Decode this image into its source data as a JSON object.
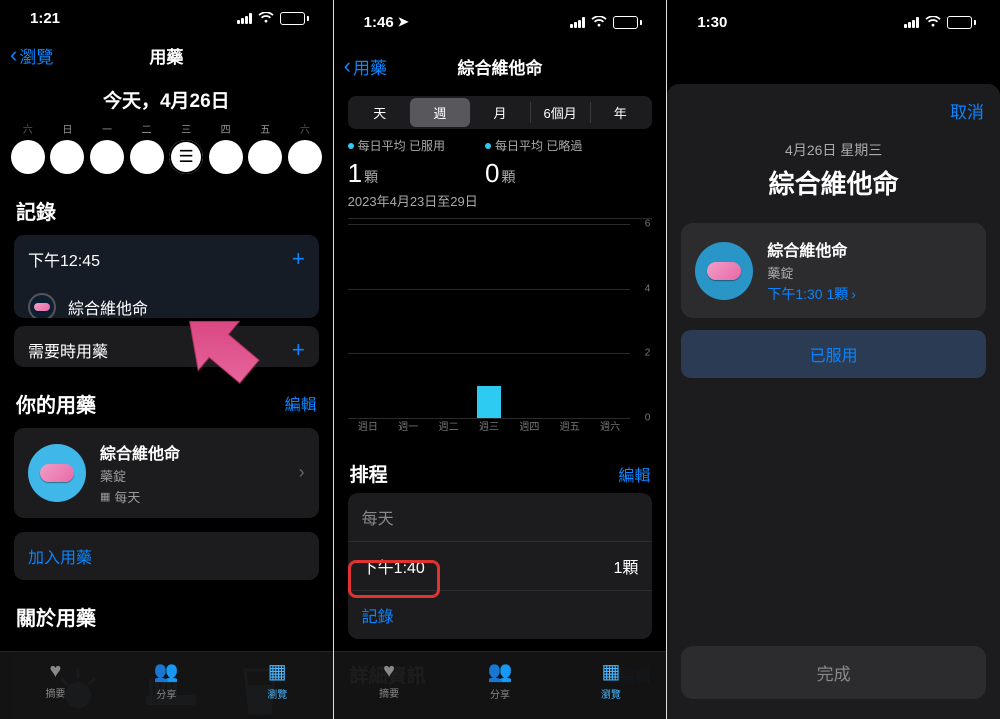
{
  "s1": {
    "time": "1:21",
    "battery": "87",
    "back": "瀏覽",
    "title": "用藥",
    "date_header": "今天，4月26日",
    "week_labels": [
      "六",
      "日",
      "一",
      "二",
      "三",
      "四",
      "五",
      "六"
    ],
    "section_log": "記錄",
    "log_time": "下午12:45",
    "med_name": "綜合維他命",
    "as_needed": "需要時用藥",
    "section_your": "你的用藥",
    "edit": "編輯",
    "med_type": "藥錠",
    "freq": "每天",
    "add_med": "加入用藥",
    "section_about": "關於用藥",
    "tabs": {
      "summary": "摘要",
      "share": "分享",
      "browse": "瀏覽"
    }
  },
  "s2": {
    "time": "1:46",
    "battery": "86",
    "back": "用藥",
    "title": "綜合維他命",
    "segs": [
      "天",
      "週",
      "月",
      "6個月",
      "年"
    ],
    "legend": {
      "taken_label": "每日平均 已服用",
      "skipped_label": "每日平均 已略過",
      "taken_val": "1",
      "skipped_val": "0",
      "unit": "顆"
    },
    "range": "2023年4月23日至29日",
    "xlabels": [
      "週日",
      "週一",
      "週二",
      "週三",
      "週四",
      "週五",
      "週六"
    ],
    "section_schedule": "排程",
    "edit": "編輯",
    "sched_freq": "每天",
    "sched_time": "下午1:40",
    "sched_qty": "1顆",
    "record": "記錄",
    "section_detail": "詳細資訊",
    "tabs": {
      "summary": "摘要",
      "share": "分享",
      "browse": "瀏覽"
    }
  },
  "s3": {
    "time": "1:30",
    "battery": "87",
    "cancel": "取消",
    "date": "4月26日 星期三",
    "title": "綜合維他命",
    "med_name": "綜合維他命",
    "med_type": "藥錠",
    "med_time": "下午1:30 1顆",
    "taken": "已服用",
    "done": "完成"
  },
  "chart_data": {
    "type": "bar",
    "categories": [
      "週日",
      "週一",
      "週二",
      "週三",
      "週四",
      "週五",
      "週六"
    ],
    "values": [
      0,
      0,
      0,
      1,
      0,
      0,
      0
    ],
    "ylim": [
      0,
      6
    ],
    "yticks": [
      0,
      2,
      4,
      6
    ],
    "series_color": "#2dcbf2",
    "range_label": "2023年4月23日至29日"
  }
}
